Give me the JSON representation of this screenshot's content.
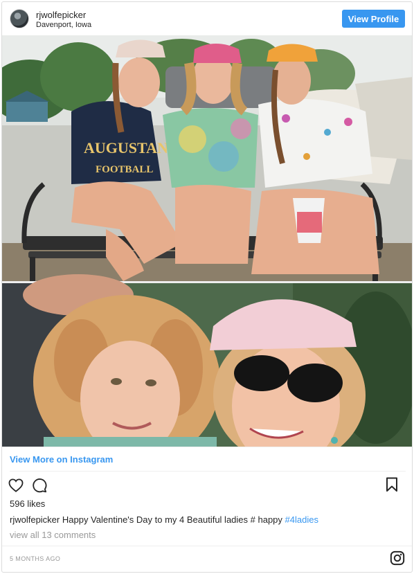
{
  "header": {
    "username": "rjwolfepicker",
    "location": "Davenport, Iowa",
    "view_profile_label": "View Profile"
  },
  "photo": {
    "top_shirt_text": "AUGUSTAN",
    "top_shirt_text_2": "FOOTBALL"
  },
  "links": {
    "view_more_label": "View More on Instagram"
  },
  "actions": {
    "like_icon": "heart-icon",
    "comment_icon": "comment-icon",
    "save_icon": "bookmark-icon"
  },
  "post": {
    "likes": "596 likes",
    "caption_user": "rjwolfepicker",
    "caption_text": " Happy Valentine's Day to my 4 Beautiful ladies # happy ",
    "caption_hashtag": "#4ladies",
    "comments_link": "view all 13 comments",
    "time_ago": "5 MONTHS AGO"
  },
  "colors": {
    "link_blue": "#3897f0",
    "muted": "#999999",
    "border": "#dbdbdb"
  }
}
